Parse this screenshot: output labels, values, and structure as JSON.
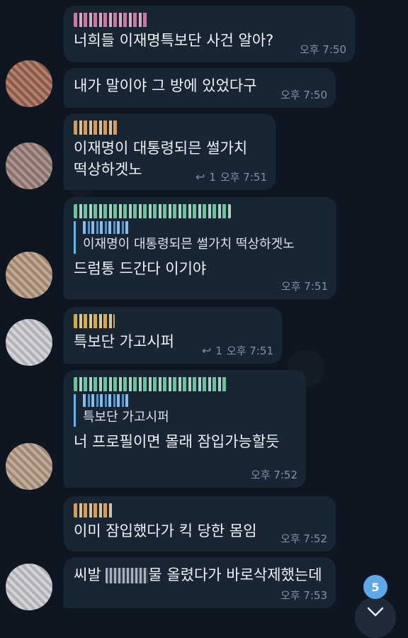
{
  "messages": [
    {
      "text": "너희들 이재명특보단 사건 알아?",
      "time": "오후 7:50"
    },
    {
      "text": "내가 말이야 그 방에 있었다구",
      "time": "오후 7:50"
    },
    {
      "text": "이재명이 대통령되믄 썰가치\n떡상하겟노",
      "time": "오후 7:51",
      "reply_count": "1"
    },
    {
      "quote_text": "이재명이 대통령되믄 썰가치 떡상하겟노",
      "text": "드럼통 드간다 이기야",
      "time": "오후 7:51"
    },
    {
      "text": "특보단 가고시퍼",
      "time": "오후 7:51",
      "reply_count": "1"
    },
    {
      "quote_text": "특보단 가고시퍼",
      "text": "너 프로필이면 몰래 잠입가능할듯",
      "time": "오후 7:52"
    },
    {
      "text": "이미 잠입했다가 킥 당한 몸임",
      "time": "오후 7:52"
    },
    {
      "text_before": "씨발 ",
      "text_after": "물 올렸다가 바로삭제했는데",
      "time": "오후 7:53"
    }
  ],
  "unread_count": "5",
  "icons": {
    "reply": "reply-arrow-icon",
    "scroll": "chevron-down-icon"
  },
  "colors": {
    "background": "#0e1621",
    "bubble": "#182533",
    "accent": "#5fa8e8"
  }
}
